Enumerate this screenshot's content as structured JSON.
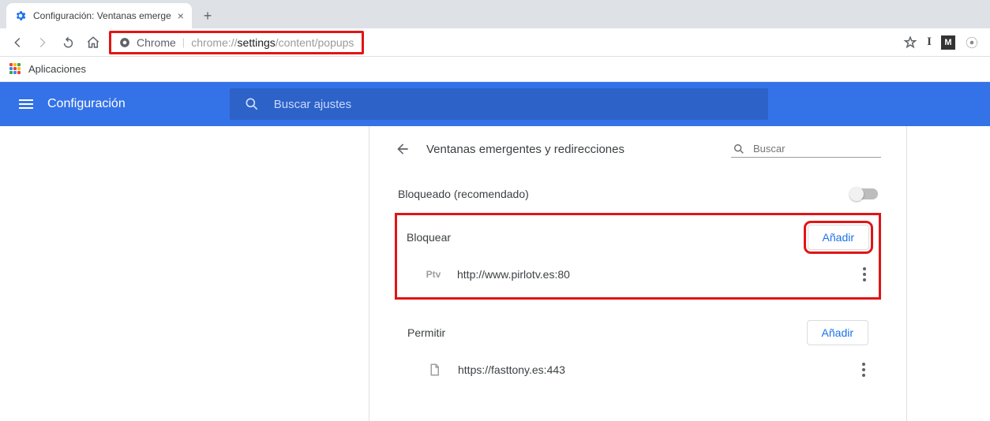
{
  "tab": {
    "title": "Configuración: Ventanas emerge"
  },
  "omnibox": {
    "scheme_label": "Chrome",
    "url_prefix": "chrome://",
    "url_bold": "settings",
    "url_suffix": "/content/popups"
  },
  "bookmarks": {
    "apps_label": "Aplicaciones"
  },
  "blue_header": {
    "title": "Configuración",
    "search_placeholder": "Buscar ajustes"
  },
  "panel": {
    "title": "Ventanas emergentes y redirecciones",
    "search_placeholder": "Buscar",
    "blocked_toggle_label": "Bloqueado (recomendado)",
    "block": {
      "title": "Bloquear",
      "add_label": "Añadir",
      "items": [
        {
          "icon_text": "Ptv",
          "url": "http://www.pirlotv.es:80"
        }
      ]
    },
    "allow": {
      "title": "Permitir",
      "add_label": "Añadir",
      "items": [
        {
          "url": "https://fasttony.es:443"
        }
      ]
    }
  },
  "apps_icon_colors": [
    "#ea4335",
    "#fbbc05",
    "#34a853",
    "#4285f4",
    "#ea4335",
    "#fbbc05",
    "#34a853",
    "#4285f4",
    "#ea4335"
  ]
}
